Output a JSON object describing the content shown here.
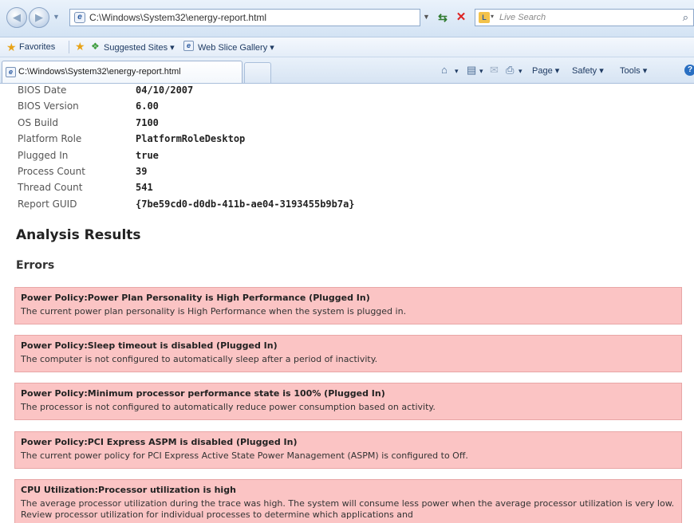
{
  "browser": {
    "address": "C:\\Windows\\System32\\energy-report.html",
    "search_placeholder": "Live Search",
    "tab_title": "C:\\Windows\\System32\\energy-report.html",
    "favorites_label": "Favorites",
    "suggested_sites_label": "Suggested Sites ▾",
    "web_slice_label": "Web Slice Gallery ▾",
    "commands": {
      "page": "Page ▾",
      "safety": "Safety ▾",
      "tools": "Tools ▾"
    }
  },
  "system_info": [
    {
      "label": "BIOS Date",
      "value": "04/10/2007"
    },
    {
      "label": "BIOS Version",
      "value": "6.00"
    },
    {
      "label": "OS Build",
      "value": "7100"
    },
    {
      "label": "Platform Role",
      "value": "PlatformRoleDesktop"
    },
    {
      "label": "Plugged In",
      "value": "true"
    },
    {
      "label": "Process Count",
      "value": "39"
    },
    {
      "label": "Thread Count",
      "value": "541"
    },
    {
      "label": "Report GUID",
      "value": "{7be59cd0-d0db-411b-ae04-3193455b9b7a}"
    }
  ],
  "analysis": {
    "title": "Analysis Results",
    "errors_title": "Errors",
    "errors": [
      {
        "title": "Power Policy:Power Plan Personality is High Performance (Plugged In)",
        "description": "The current power plan personality is High Performance when the system is plugged in."
      },
      {
        "title": "Power Policy:Sleep timeout is disabled (Plugged In)",
        "description": "The computer is not configured to automatically sleep after a period of inactivity."
      },
      {
        "title": "Power Policy:Minimum processor performance state is 100% (Plugged In)",
        "description": "The processor is not configured to automatically reduce power consumption based on activity."
      },
      {
        "title": "Power Policy:PCI Express ASPM is disabled (Plugged In)",
        "description": "The current power policy for PCI Express Active State Power Management (ASPM) is configured to Off."
      },
      {
        "title": "CPU Utilization:Processor utilization is high",
        "description": "The average processor utilization during the trace was high. The system will consume less power when the average processor utilization is very low. Review processor utilization for individual processes to determine which applications and"
      }
    ]
  },
  "colors": {
    "error_bg": "#fbc4c4",
    "error_border": "#e8a6a6"
  }
}
